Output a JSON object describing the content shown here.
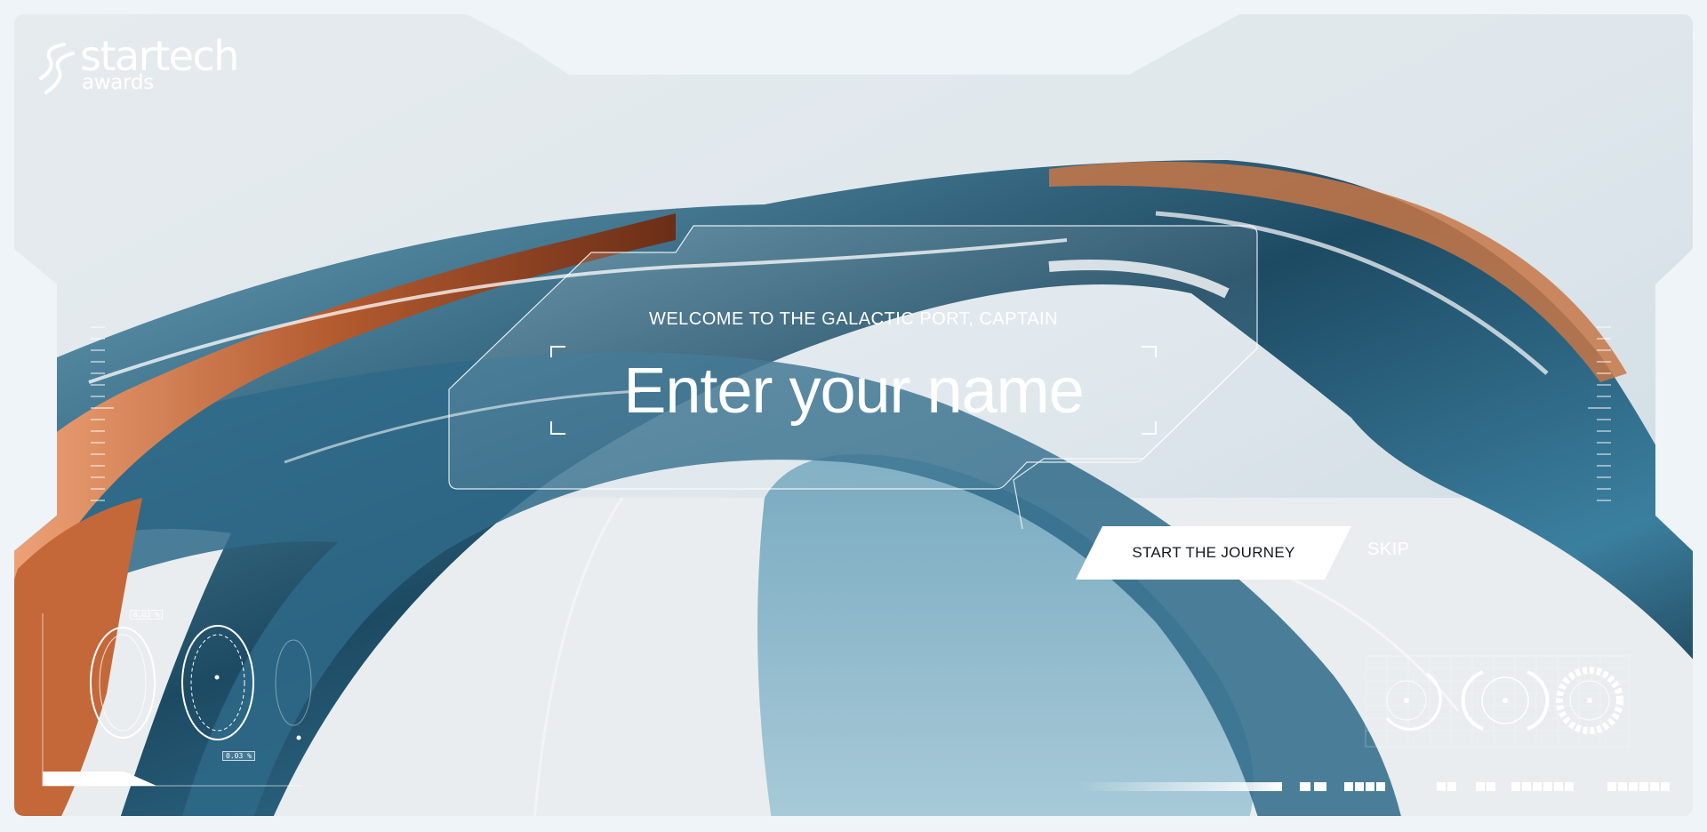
{
  "logo": {
    "word": "startech",
    "sub": "awards"
  },
  "intro": {
    "welcome": "WELCOME TO THE GALACTIC PORT, CAPTAIN",
    "name_placeholder": "Enter your name",
    "name_value": ""
  },
  "actions": {
    "start_label": "START THE JOURNEY",
    "skip_label": "SKIP"
  },
  "hud": {
    "left_gauge_top_label": "0.03 %",
    "left_gauge_bottom_label": "0.03 %",
    "loading_progress": 0.22
  },
  "colors": {
    "accent_blue": "#3f7f9b",
    "accent_copper": "#c86a3c",
    "frame": "#eef4f7",
    "text_light": "#ffffff",
    "button_text": "#15191d"
  }
}
